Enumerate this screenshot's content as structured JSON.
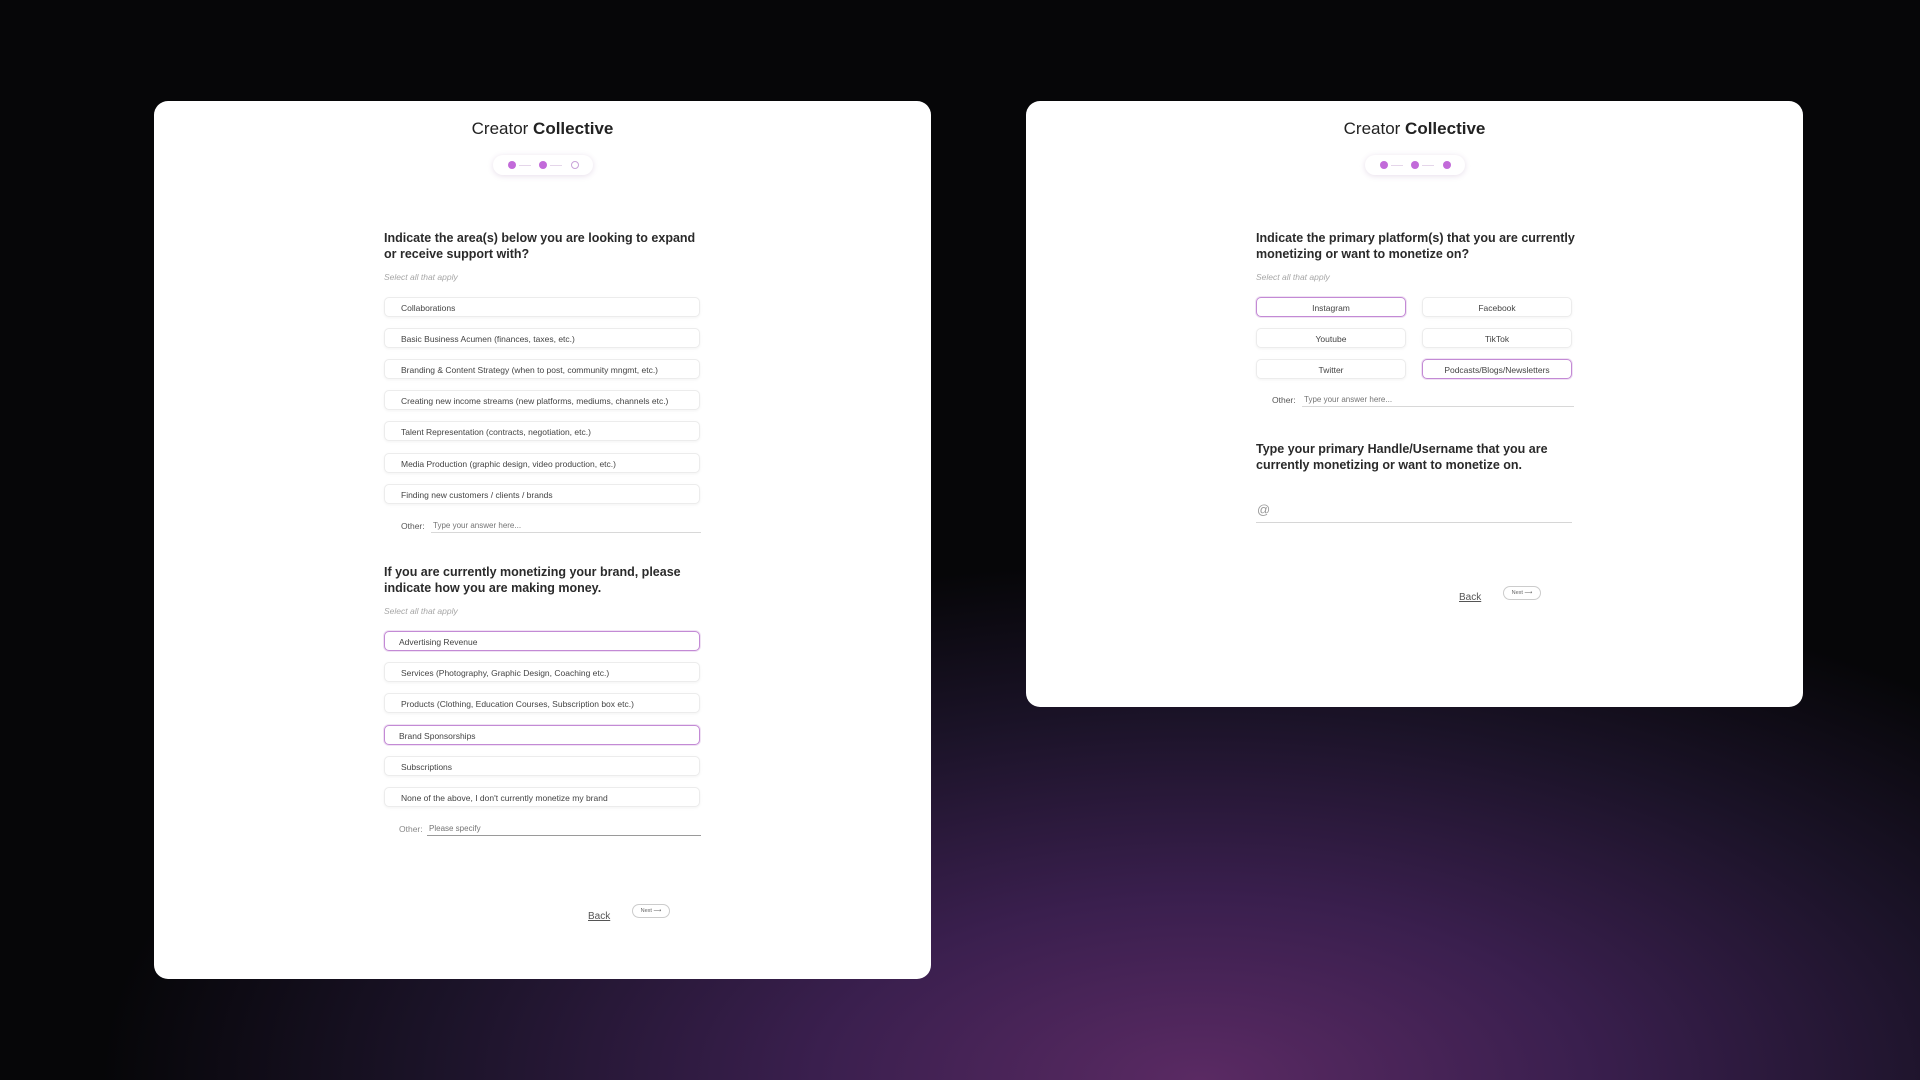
{
  "brand": {
    "light": "Creator",
    "bold": "Collective"
  },
  "left": {
    "q1": "Indicate the area(s) below you are looking to expand or receive support with?",
    "hint1": "Select all that apply",
    "options1": [
      "Collaborations",
      "Basic Business Acumen (finances, taxes, etc.)",
      "Branding & Content Strategy (when to post, community mngmt, etc.)",
      "Creating new income streams (new platforms, mediums, channels etc.)",
      "Talent Representation (contracts, negotiation, etc.)",
      "Media Production (graphic design, video production, etc.)",
      "Finding new customers / clients / brands"
    ],
    "other1_label": "Other:",
    "other1_placeholder": "Type your answer here...",
    "q2": "If you are currently monetizing your brand, please indicate how you are making money.",
    "hint2": "Select all that apply",
    "options2": [
      "Advertising Revenue",
      "Services (Photography, Graphic Design, Coaching etc.)",
      "Products (Clothing, Education Courses, Subscription box etc.)",
      "Brand Sponsorships",
      "Subscriptions",
      "None of the above, I don't currently monetize my brand"
    ],
    "selected2": [
      "Advertising Revenue",
      "Brand Sponsorships"
    ],
    "other2_label": "Other:",
    "other2_placeholder": "Please specify",
    "back": "Back",
    "next": "Next ⟶"
  },
  "right": {
    "q1": "Indicate the primary platform(s) that you are currently monetizing or want to monetize on?",
    "hint1": "Select all that apply",
    "platforms": [
      "Instagram",
      "Facebook",
      "Youtube",
      "TikTok",
      "Twitter",
      "Podcasts/Blogs/Newsletters"
    ],
    "selected": [
      "Instagram",
      "Podcasts/Blogs/Newsletters"
    ],
    "other_label": "Other:",
    "other_placeholder": "Type your answer here...",
    "q2": "Type your primary Handle/Username that you are currently monetizing or want to monetize on.",
    "at": "@",
    "back": "Back",
    "next": "Next ⟶"
  },
  "colors": {
    "accent": "#c26ad9",
    "selected_border": "#c38ad5"
  },
  "stepper": {
    "current_step": 2,
    "total_steps": 3
  }
}
